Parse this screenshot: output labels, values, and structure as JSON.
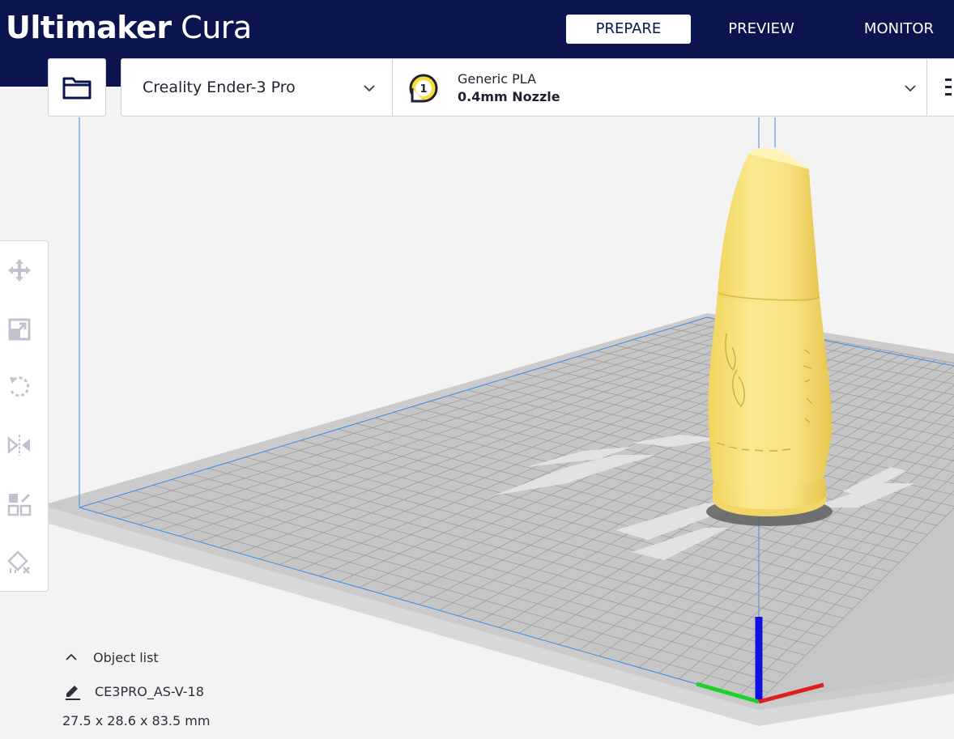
{
  "app": {
    "brand_bold": "Ultimaker",
    "brand_light": "Cura"
  },
  "stages": [
    {
      "label": "PREPARE",
      "active": true
    },
    {
      "label": "PREVIEW",
      "active": false
    },
    {
      "label": "MONITOR",
      "active": false
    }
  ],
  "toolbar": {
    "open_file_icon": "folder-icon"
  },
  "printer": {
    "name": "Creality Ender-3 Pro"
  },
  "extruder": {
    "index": "1",
    "material": "Generic PLA",
    "nozzle": "0.4mm Nozzle"
  },
  "tools": [
    {
      "name": "move-icon"
    },
    {
      "name": "scale-icon"
    },
    {
      "name": "rotate-icon"
    },
    {
      "name": "mirror-icon"
    },
    {
      "name": "per-model-settings-icon"
    },
    {
      "name": "support-blocker-icon"
    }
  ],
  "object_list": {
    "title": "Object list",
    "item_name": "CE3PRO_AS-V-18",
    "dimensions": "27.5 x 28.6 x 83.5 mm"
  },
  "colors": {
    "header_bg": "#0c1450",
    "model": "#f7e07a",
    "build_plate": "#c9c9c9",
    "axis_x": "#e02020",
    "axis_y": "#1fd02f",
    "axis_z": "#1010e0"
  }
}
